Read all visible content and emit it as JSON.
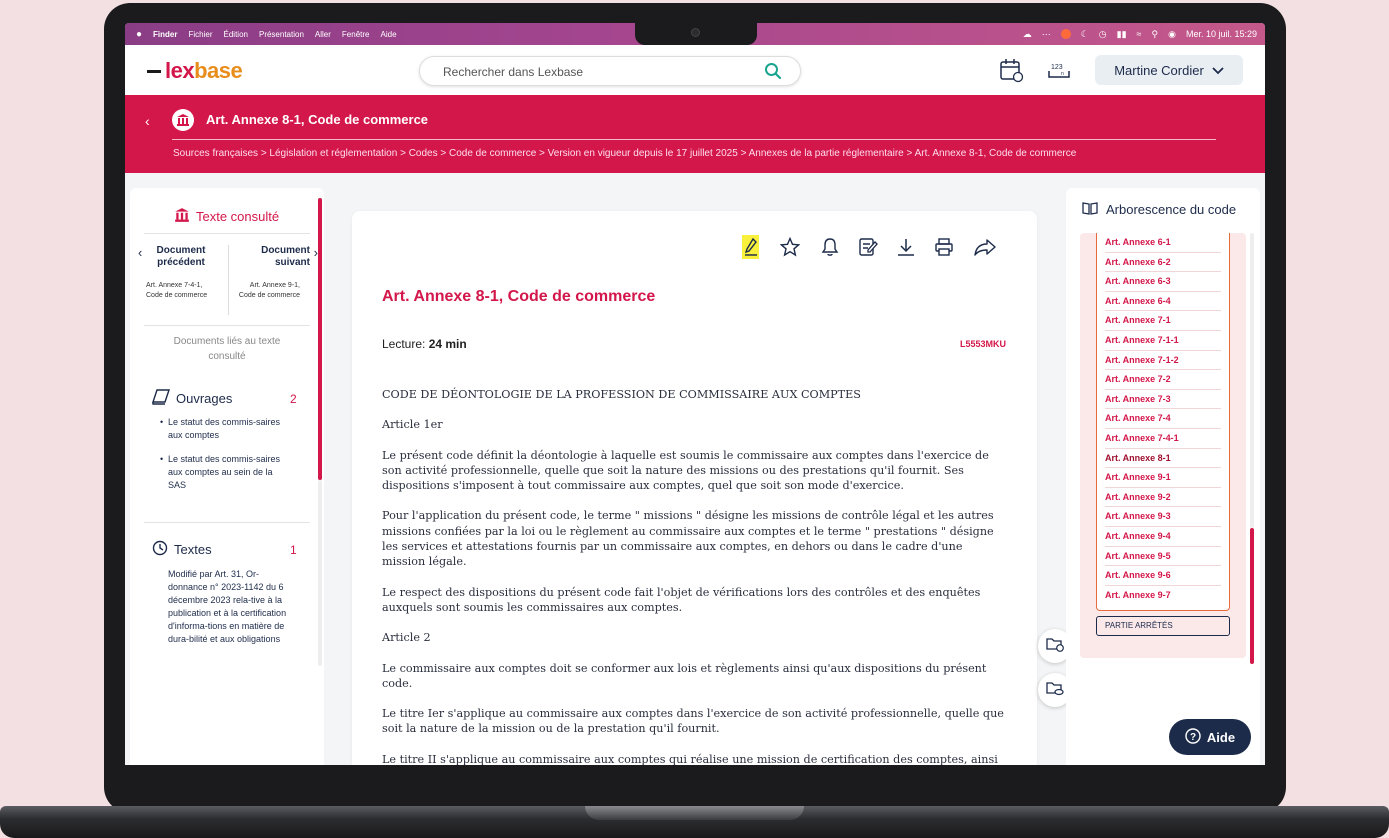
{
  "menubar": {
    "apple": "",
    "items": [
      "Finder",
      "Fichier",
      "Édition",
      "Présentation",
      "Aller",
      "Fenêtre",
      "Aide"
    ],
    "clock": "Mer. 10 juil. 15:29"
  },
  "header": {
    "logo_prefix": "lex",
    "logo_suffix": "base",
    "search_placeholder": "Rechercher dans Lexbase",
    "user_name": "Martine Cordier"
  },
  "banner": {
    "title": "Art. Annexe 8-1, Code de commerce",
    "breadcrumb": "Sources françaises > Législation et réglementation > Codes > Code de commerce > Version en vigueur depuis le 17 juillet 2025 > Annexes de la partie réglementaire > Art. Annexe 8-1, Code de commerce"
  },
  "left_panel": {
    "title": "Texte consulté",
    "prev_label": "Document précédent",
    "prev_sub": "Art. Annexe 7-4-1, Code de commerce",
    "next_label": "Document suivant",
    "next_sub": "Art. Annexe 9-1, Code de commerce",
    "linked_label": "Documents liés au texte consulté",
    "ouvrages_label": "Ouvrages",
    "ouvrages_count": "2",
    "ouvrages_items": [
      "Le statut des commis-saires aux comptes",
      "Le statut des commis-saires aux comptes au sein de la SAS"
    ],
    "textes_label": "Textes",
    "textes_count": "1",
    "textes_item": "Modifié par Art. 31, Or-donnance n° 2023-1142 du 6 décembre 2023 rela-tive à la publication et à la certification d'informa-tions en matière de dura-bilité et aux obligations"
  },
  "document": {
    "title": "Art. Annexe 8-1, Code de commerce",
    "lecture_label": "Lecture:",
    "lecture_value": "24 min",
    "ref": "L5553MKU",
    "paragraphs": [
      "CODE DE DÉONTOLOGIE DE LA PROFESSION DE COMMISSAIRE AUX COMPTES",
      "Article 1er",
      "Le présent code définit la déontologie à laquelle est soumis le commissaire aux comptes dans l'exercice de son activité professionnelle, quelle que soit la nature des missions ou des prestations qu'il fournit. Ses dispositions s'imposent à tout commissaire aux comptes, quel que soit son mode d'exercice.",
      "Pour l'application du présent code, le terme \" missions \" désigne les missions de contrôle légal et les autres missions confiées par la loi ou le règlement au commissaire aux comptes et le terme \" prestations \" désigne les services et attestations fournis par un commissaire aux comptes, en dehors ou dans le cadre d'une mission légale.",
      "Le respect des dispositions du présent code fait l'objet de vérifications lors des contrôles et des enquêtes auxquels sont soumis les commissaires aux comptes.",
      "Article 2",
      "Le commissaire aux comptes doit se conformer aux lois et règlements ainsi qu'aux dispositions du présent code.",
      "Le titre Ier s'applique au commissaire aux comptes dans l'exercice de son activité professionnelle, quelle que soit la nature de la mission ou de la prestation qu'il fournit.",
      "Le titre II s'applique au commissaire aux comptes qui réalise une mission de certification des comptes, ainsi qu'une autre mission ou une prestation pour l'entité dont il certifie les comptes."
    ]
  },
  "right_panel": {
    "title": "Arborescence du code",
    "items": [
      "Art. Annexe 6-1",
      "Art. Annexe 6-2",
      "Art. Annexe 6-3",
      "Art. Annexe 6-4",
      "Art. Annexe 7-1",
      "Art. Annexe 7-1-1",
      "Art. Annexe 7-1-2",
      "Art. Annexe 7-2",
      "Art. Annexe 7-3",
      "Art. Annexe 7-4",
      "Art. Annexe 7-4-1",
      "Art. Annexe 8-1",
      "Art. Annexe 9-1",
      "Art. Annexe 9-2",
      "Art. Annexe 9-3",
      "Art. Annexe 9-4",
      "Art. Annexe 9-5",
      "Art. Annexe 9-6",
      "Art. Annexe 9-7"
    ],
    "active": "Art. Annexe 8-1",
    "parties": "PARTIE ARRÊTÉS"
  },
  "help": {
    "label": "Aide"
  },
  "colors": {
    "brand": "#d3174a",
    "navy": "#1d2b4a",
    "highlight": "#f8f03a"
  }
}
